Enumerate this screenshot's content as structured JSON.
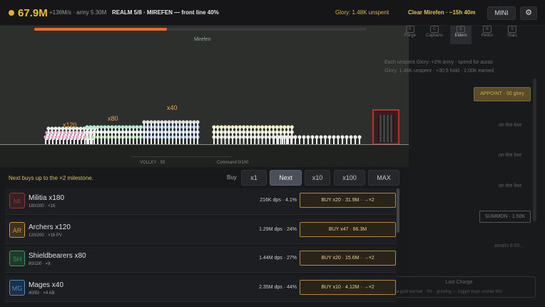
{
  "header": {
    "gold": "67.9M",
    "rate": "+136M/s · army 5.30M",
    "realm": "REALM 5/8 · MIREFEN — front line 40%",
    "glory": "Glory: 1.48K unspent",
    "clear": "Clear Mirefen · ~15h 40m",
    "mini_label": "MINI",
    "settings_glyph": "⚙",
    "progress": 0.4
  },
  "battlefield": {
    "name": "Mirefen",
    "volley": "VOLLEY · 50",
    "command": "Command 0/100",
    "stack_labels": [
      "x120",
      "x80",
      "x40"
    ]
  },
  "sidebar": {
    "tabs": [
      {
        "icon": "F",
        "label": "Forge"
      },
      {
        "icon": "C",
        "label": "Captains"
      },
      {
        "icon": "E",
        "label": "Elders"
      },
      {
        "icon": "R",
        "label": "Relics"
      },
      {
        "icon": "S",
        "label": "Stats"
      }
    ],
    "note1": "Each unspent Glory: +2% army · spend for auras",
    "note2": "Glory: 1.48K unspent · +30.5 hold · 2.00K earned",
    "appoint": "APPOINT · 50 glory",
    "on_line": "on the line",
    "summon": "SUMMON · 1.50K",
    "awaits": "awaits 6:00...",
    "last_charge_title": "Last Charge",
    "last_charge_sub": "... total gold earned · 0% · growing — bigger buys sooner this"
  },
  "buybar": {
    "hint": "Next buys up to the ×2 milestone.",
    "label": "Buy",
    "options": [
      "x1",
      "Next",
      "x10",
      "x100",
      "MAX"
    ],
    "selected": "Next"
  },
  "units": [
    {
      "abbr": "MI",
      "name": "Militia  x180",
      "sub": "180/200 · ×16",
      "dps": "216K dps · 4.1%",
      "buy": "BUY x20 · 31.9M · →×2",
      "color": "#8a3a3a",
      "bg": "#3a2022"
    },
    {
      "abbr": "AR",
      "name": "Archers  x120",
      "sub": "120/200 · ×16  PV",
      "dps": "1.29M dps · 24%",
      "buy": "BUY x47 · 66.3M",
      "color": "#c4983a",
      "bg": "#3d3220"
    },
    {
      "abbr": "SH",
      "name": "Shieldbearers  x80",
      "sub": "80/100 · ×8",
      "dps": "1.44M dps · 27%",
      "buy": "BUY x20 · 15.6M · →×2",
      "color": "#3a9a64",
      "bg": "#1d3a2a"
    },
    {
      "abbr": "MG",
      "name": "Mages  x40",
      "sub": "40/50 · ×4  AB",
      "dps": "2.35M dps · 44%",
      "buy": "BUY x10 · 4.12M · →×2",
      "color": "#4a8ac8",
      "bg": "#1e2e44"
    }
  ]
}
